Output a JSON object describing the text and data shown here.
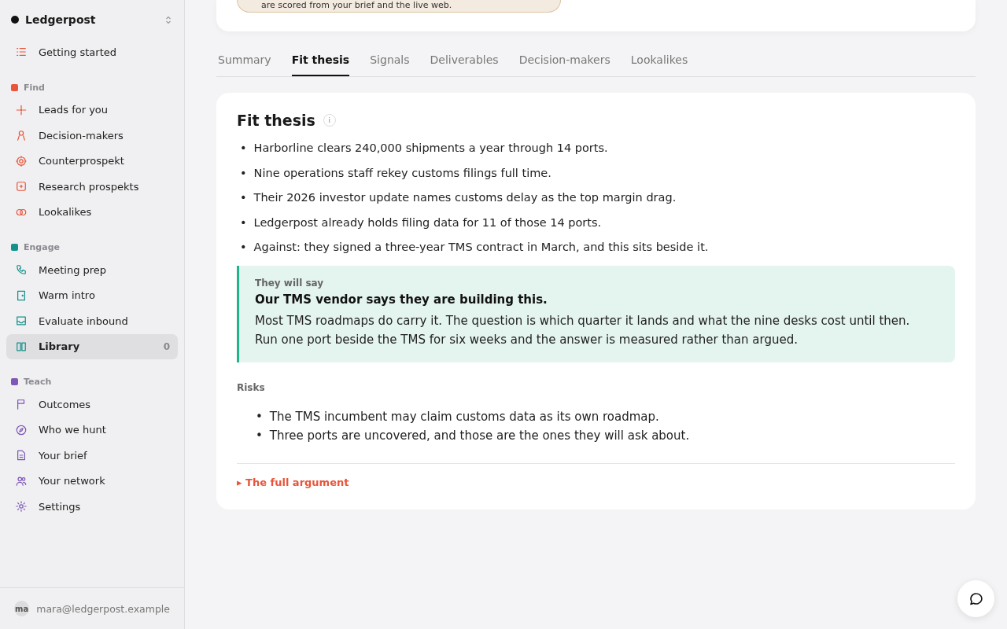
{
  "workspace": {
    "name": "Ledgerpost"
  },
  "sidebar": {
    "top_items": [
      {
        "label": "Getting started",
        "selected": false
      }
    ],
    "sections": [
      {
        "title": "Find",
        "color": "#e8553a",
        "items": [
          {
            "label": "Leads for you",
            "selected": false
          },
          {
            "label": "Decision-makers",
            "selected": false
          },
          {
            "label": "Counterprospekt",
            "selected": false
          },
          {
            "label": "Research prospekts",
            "selected": false
          },
          {
            "label": "Lookalikes",
            "selected": false
          }
        ]
      },
      {
        "title": "Engage",
        "color": "#14918a",
        "items": [
          {
            "label": "Meeting prep",
            "selected": false
          },
          {
            "label": "Warm intro",
            "selected": false
          },
          {
            "label": "Evaluate inbound",
            "selected": false
          },
          {
            "label": "Library",
            "selected": true,
            "count": "0"
          }
        ]
      },
      {
        "title": "Teach",
        "color": "#7e57b8",
        "items": [
          {
            "label": "Outcomes",
            "selected": false
          },
          {
            "label": "Who we hunt",
            "selected": false
          },
          {
            "label": "Your brief",
            "selected": false
          },
          {
            "label": "Your network",
            "selected": false
          },
          {
            "label": "Settings",
            "selected": false
          }
        ]
      }
    ],
    "user": {
      "initials": "ma",
      "email": "mara@ledgerpost.example"
    }
  },
  "top_card": {
    "note": "are scored from your brief and the live web."
  },
  "tabs": [
    {
      "label": "Summary",
      "selected": false
    },
    {
      "label": "Fit thesis",
      "selected": true
    },
    {
      "label": "Signals",
      "selected": false
    },
    {
      "label": "Deliverables",
      "selected": false
    },
    {
      "label": "Decision-makers",
      "selected": false
    },
    {
      "label": "Lookalikes",
      "selected": false
    }
  ],
  "panel": {
    "title": "Fit thesis",
    "info": "i",
    "bullet": "•",
    "points": [
      "Harborline clears 240,000 shipments a year through 14 ports.",
      "Nine operations staff rekey customs filings full time.",
      "Their 2026 investor update names customs delay as the top margin drag.",
      "Ledgerpost already holds filing data for 11 of those 14 ports.",
      "Against: they signed a three-year TMS contract in March, and this sits beside it."
    ],
    "objection": {
      "label": "They will say",
      "title": "Our TMS vendor says they are building this.",
      "body": "Most TMS roadmaps do carry it. The question is which quarter it lands and what the nine desks cost until then. Run one port beside the TMS for six weeks and the answer is measured rather than argued."
    },
    "risks_title": "Risks",
    "risks": [
      "The TMS incumbent may claim customs data as its own roadmap.",
      "Three ports are uncovered, and those are the ones they will ask about."
    ],
    "more": {
      "marker": "▸",
      "label": "The full argument",
      "expanded": false
    }
  }
}
